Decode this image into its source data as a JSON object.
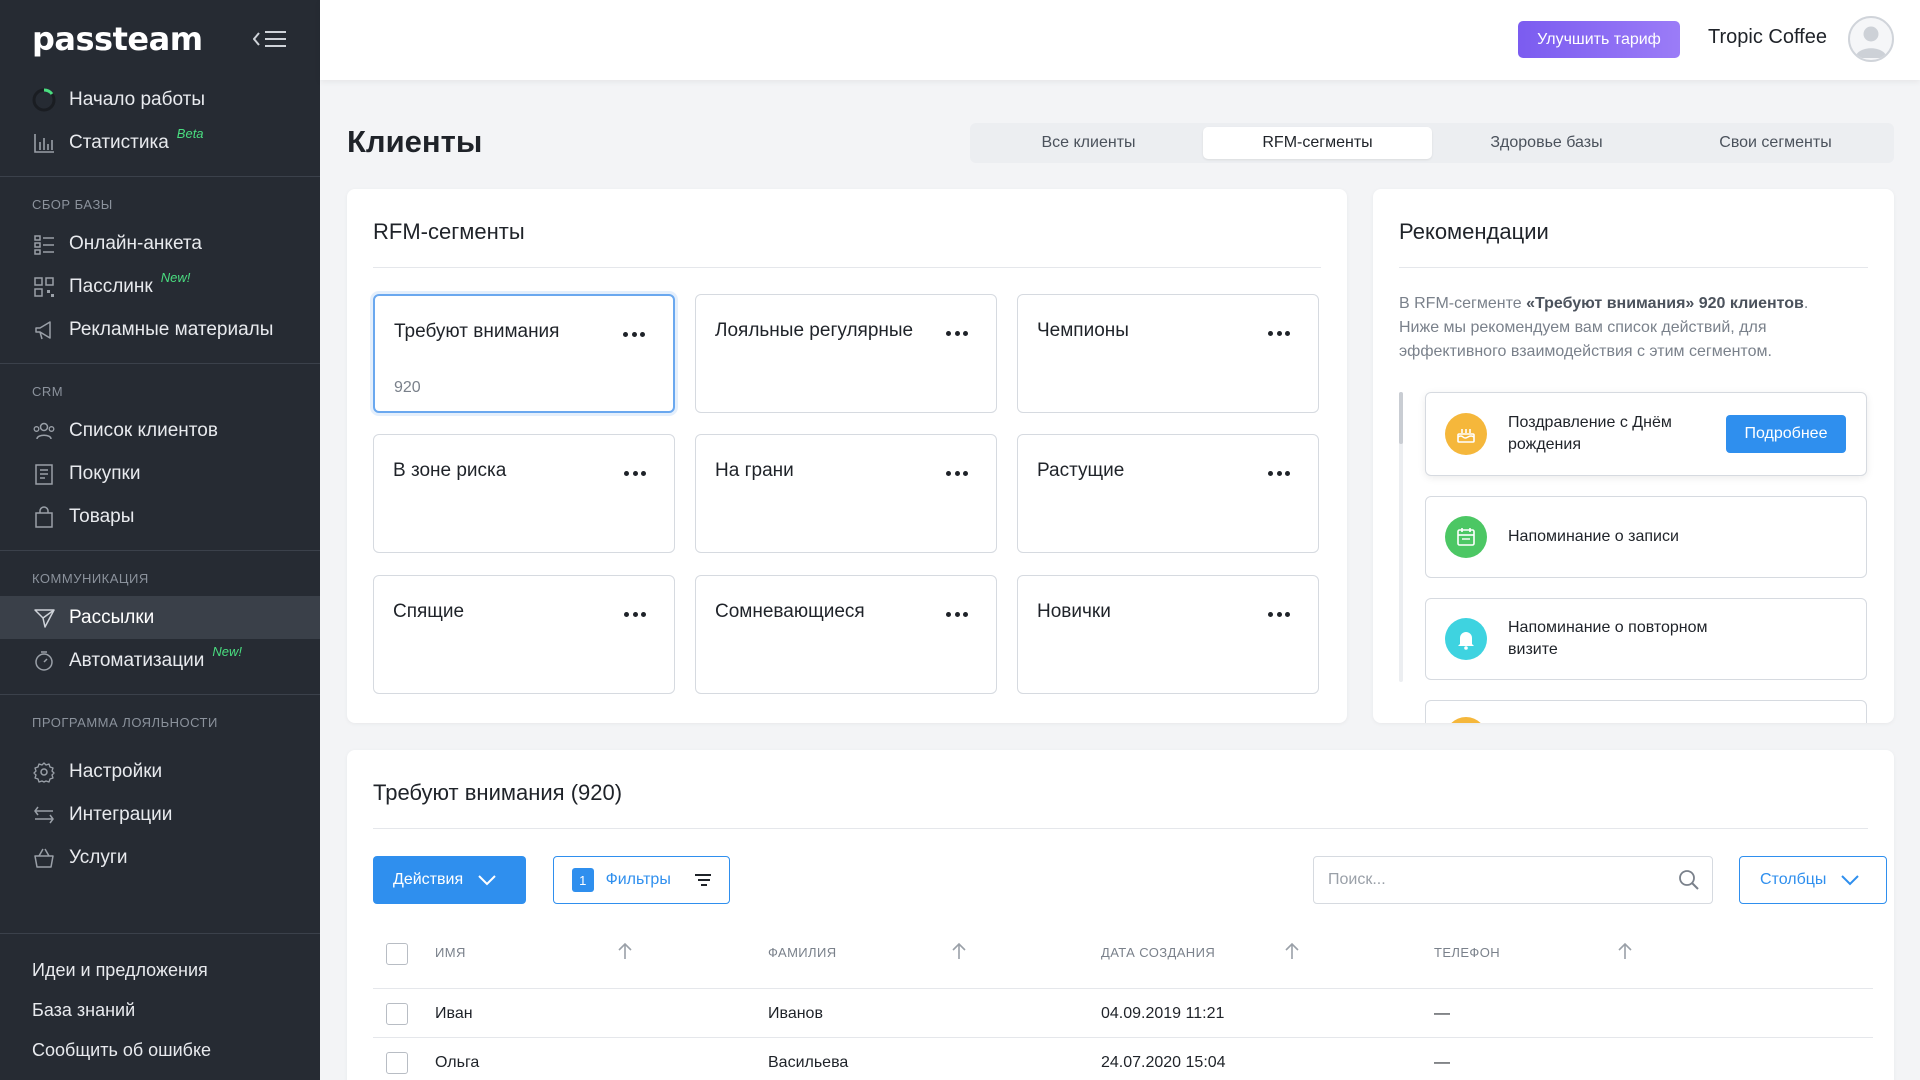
{
  "sidebar": {
    "logo": "passteam",
    "top_items": [
      {
        "label": "Начало работы",
        "icon": "progress-ring-icon"
      },
      {
        "label": "Статистика",
        "icon": "bar-chart-icon",
        "tag": "Beta"
      }
    ],
    "sections": [
      {
        "title": "СБОР БАЗЫ",
        "items": [
          {
            "label": "Онлайн-анкета",
            "icon": "form-icon"
          },
          {
            "label": "Пасслинк",
            "icon": "qr-code-icon",
            "tag": "New!"
          },
          {
            "label": "Рекламные материалы",
            "icon": "megaphone-icon"
          }
        ]
      },
      {
        "title": "CRM",
        "items": [
          {
            "label": "Список клиентов",
            "icon": "users-icon"
          },
          {
            "label": "Покупки",
            "icon": "receipt-icon"
          },
          {
            "label": "Товары",
            "icon": "shopping-bag-icon"
          }
        ]
      },
      {
        "title": "КОММУНИКАЦИЯ",
        "items": [
          {
            "label": "Рассылки",
            "icon": "send-icon",
            "active": true
          },
          {
            "label": "Автоматизации",
            "icon": "timer-icon",
            "tag": "New!"
          }
        ]
      },
      {
        "title": "ПРОГРАММА ЛОЯЛЬНОСТИ",
        "items": []
      }
    ],
    "bottom_items": [
      {
        "label": "Настройки",
        "icon": "gear-icon"
      },
      {
        "label": "Интеграции",
        "icon": "arrows-swap-icon"
      },
      {
        "label": "Услуги",
        "icon": "basket-icon"
      }
    ],
    "footer_links": [
      "Идеи и предложения",
      "База знаний",
      "Сообщить об ошибке"
    ]
  },
  "topbar": {
    "upgrade_label": "Улучшить тариф",
    "company": "Tropic Coffee",
    "upgrade_color": "#8a6cf3"
  },
  "page": {
    "title": "Клиенты",
    "tabs": [
      {
        "label": "Все клиенты"
      },
      {
        "label": "RFM-сегменты",
        "active": true
      },
      {
        "label": "Здоровье базы"
      },
      {
        "label": "Свои сегменты"
      }
    ]
  },
  "rfm": {
    "title": "RFM-сегменты",
    "segments": [
      {
        "name": "Требуют внимания",
        "count": "920",
        "selected": true
      },
      {
        "name": "Лояльные регулярные"
      },
      {
        "name": "Чемпионы"
      },
      {
        "name": "В зоне риска"
      },
      {
        "name": "На грани"
      },
      {
        "name": "Растущие"
      },
      {
        "name": "Спящие"
      },
      {
        "name": "Сомневающиеся"
      },
      {
        "name": "Новички"
      }
    ]
  },
  "recommendations": {
    "title": "Рекомендации",
    "text_before": "В RFM-сегменте ",
    "text_bold": "«Требуют внимания» 920 клиентов",
    "text_after": ". Ниже мы рекомендуем вам список действий, для эффективного взаимодействия с этим сегментом.",
    "items": [
      {
        "label": "Поздравление с Днём рождения",
        "icon": "cake-icon",
        "color": "#f5b73b",
        "button": "Подробнее"
      },
      {
        "label": "Напоминание о записи",
        "icon": "calendar-icon",
        "color": "#4cc764"
      },
      {
        "label": "Напоминание о повторном визите",
        "icon": "bell-icon",
        "color": "#3ed3e0"
      }
    ]
  },
  "table": {
    "title": "Требуют внимания (920)",
    "actions_label": "Действия",
    "filters_label": "Фильтры",
    "filters_count": "1",
    "search_placeholder": "Поиск...",
    "columns_label": "Столбцы",
    "headers": [
      "ИМЯ",
      "ФАМИЛИЯ",
      "ДАТА СОЗДАНИЯ",
      "ТЕЛЕФОН"
    ],
    "rows": [
      {
        "first": "Иван",
        "last": "Иванов",
        "created": "04.09.2019 11:21",
        "phone": "—"
      },
      {
        "first": "Ольга",
        "last": "Васильева",
        "created": "24.07.2020 15:04",
        "phone": "—"
      }
    ]
  },
  "colors": {
    "accent": "#2f8fee",
    "sidebar_bg": "#262b33",
    "new_tag": "#4ade80"
  }
}
